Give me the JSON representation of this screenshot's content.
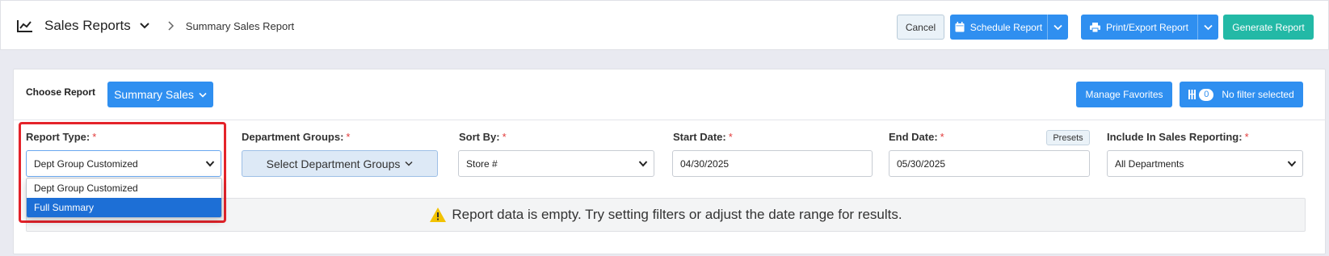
{
  "header": {
    "title": "Sales Reports",
    "breadcrumb_current": "Summary Sales Report",
    "cancel_label": "Cancel",
    "schedule_label": "Schedule Report",
    "print_export_label": "Print/Export Report",
    "generate_label": "Generate Report"
  },
  "report_bar": {
    "choose_label": "Choose Report",
    "choose_value": "Summary Sales",
    "manage_favorites_label": "Manage Favorites",
    "filter_count": "0",
    "filter_label": "No filter selected"
  },
  "filters": {
    "report_type": {
      "label": "Report Type:",
      "required": "*",
      "value": "Dept Group Customized",
      "options": [
        "Dept Group Customized",
        "Full Summary"
      ],
      "highlighted_option": "Full Summary"
    },
    "department_groups": {
      "label": "Department Groups:",
      "required": "*",
      "value": "Select Department Groups"
    },
    "sort_by": {
      "label": "Sort By:",
      "required": "*",
      "value": "Store #"
    },
    "start_date": {
      "label": "Start Date:",
      "required": "*",
      "value": "04/30/2025"
    },
    "end_date": {
      "label": "End Date:",
      "required": "*",
      "value": "05/30/2025",
      "presets_label": "Presets"
    },
    "include_in_sales": {
      "label": "Include In Sales Reporting:",
      "required": "*",
      "value": "All Departments"
    }
  },
  "notice": {
    "text": "Report data is empty. Try setting filters or adjust the date range for results."
  },
  "colors": {
    "primary": "#2f8ff0",
    "success": "#23b9a6",
    "danger_highlight": "#e4232a",
    "selected_option": "#1d6fd6",
    "warning_icon": "#f2c200"
  },
  "icons": [
    "chart-line-icon",
    "chevron-down-icon",
    "chevron-right-icon",
    "calendar-icon",
    "printer-icon",
    "filter-icon",
    "warning-icon"
  ]
}
